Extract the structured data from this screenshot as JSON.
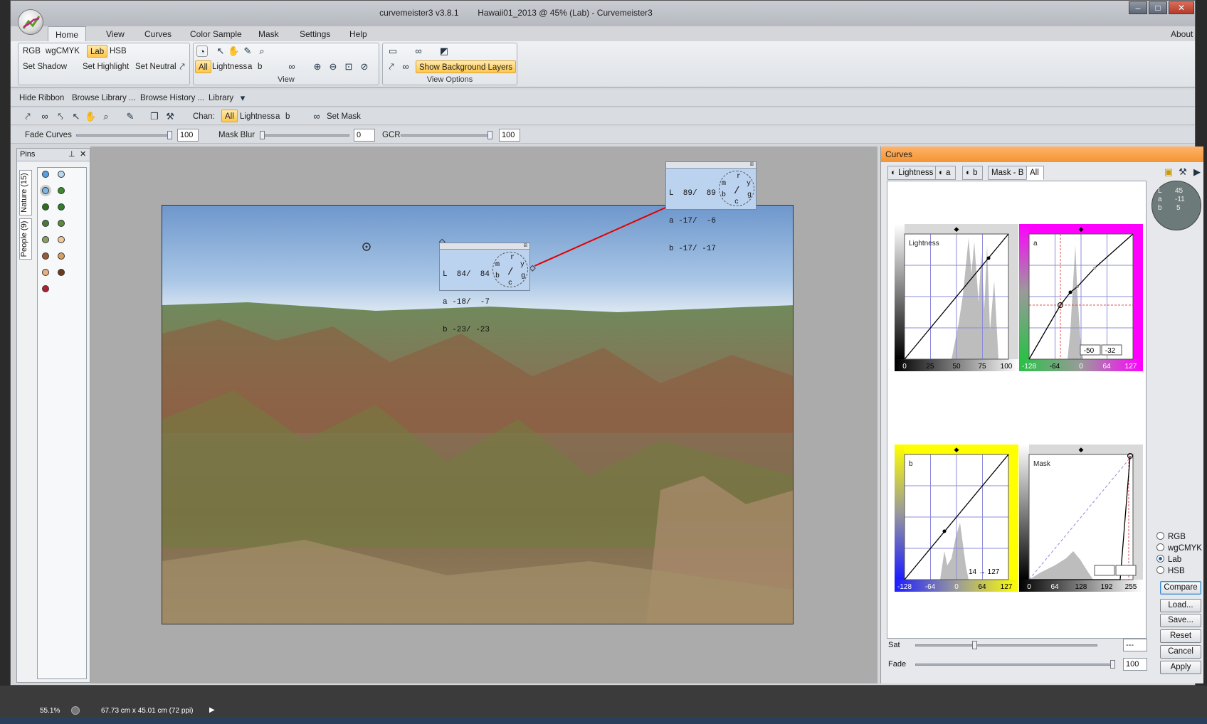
{
  "window": {
    "app_version": "curvemeister3 v3.8.1",
    "document_title": "Hawaii01_2013 @ 45% (Lab) - Curvemeister3"
  },
  "menu": {
    "tabs": [
      "Home",
      "View",
      "Curves",
      "Color Sample",
      "Mask",
      "Settings",
      "Help"
    ],
    "about": "About"
  },
  "ribbon": {
    "modes": [
      "RGB",
      "wgCMYK",
      "Lab",
      "HSB"
    ],
    "set_buttons": [
      "Set Shadow",
      "Set Highlight",
      "Set Neutral"
    ],
    "channels": [
      "All",
      "Lightness",
      "a",
      "b"
    ],
    "view_group_label": "View",
    "show_background_layers": "Show Background Layers",
    "view_options_label": "View Options"
  },
  "quickbar": {
    "hide_ribbon": "Hide Ribbon",
    "browse_library": "Browse Library ...",
    "browse_history": "Browse History ...",
    "library": "Library"
  },
  "toolbar": {
    "chan_label": "Chan:",
    "channels": [
      "All",
      "Lightness",
      "a",
      "b"
    ],
    "set_mask": "Set Mask"
  },
  "sliders": {
    "fade_curves_label": "Fade Curves",
    "fade_curves_value": "100",
    "mask_blur_label": "Mask Blur",
    "mask_blur_value": "0",
    "gcr_label": "GCR",
    "gcr_value": "100"
  },
  "pins": {
    "title": "Pins",
    "tab_nature": "Nature (15)",
    "tab_people": "People (9)"
  },
  "readouts": {
    "r1": {
      "lines": [
        "L  84/  84",
        "a -18/  -7",
        "b -23/ -23"
      ]
    },
    "r2": {
      "lines": [
        "L  89/  89",
        "a -17/  -6",
        "b -17/ -17"
      ]
    },
    "wheel_letters": [
      "r",
      "y",
      "m",
      "g",
      "b",
      "c"
    ]
  },
  "curves": {
    "title": "Curves",
    "tabs": [
      "Lightness",
      "a",
      "b",
      "Mask - B",
      "All"
    ],
    "mini_readout": {
      "L": "45",
      "a": "-11",
      "b": "5"
    },
    "lightness": {
      "label": "Lightness",
      "ticks": [
        "0",
        "25",
        "50",
        "75",
        "100"
      ]
    },
    "a": {
      "label": "a",
      "ticks": [
        "-128",
        "-64",
        "0",
        "64",
        "127"
      ],
      "in_value": "-50",
      "out_value": "-32"
    },
    "b": {
      "label": "b",
      "ticks": [
        "-128",
        "-64",
        "0",
        "64",
        "127"
      ],
      "in_out": "14 → 127"
    },
    "mask": {
      "label": "Mask",
      "ticks": [
        "0",
        "64",
        "128",
        "192",
        "255"
      ]
    },
    "color_modes": [
      "RGB",
      "wgCMYK",
      "Lab",
      "HSB"
    ],
    "selected_mode": "Lab",
    "buttons": [
      "Compare",
      "Load...",
      "Save...",
      "Reset",
      "Cancel",
      "Apply"
    ],
    "sat_label": "Sat",
    "sat_value": "---",
    "fade_label": "Fade",
    "fade_value": "100"
  },
  "statusbar": {
    "zoom": "55.1%",
    "doc_size": "67.73 cm x 45.01 cm (72 ppi)"
  }
}
